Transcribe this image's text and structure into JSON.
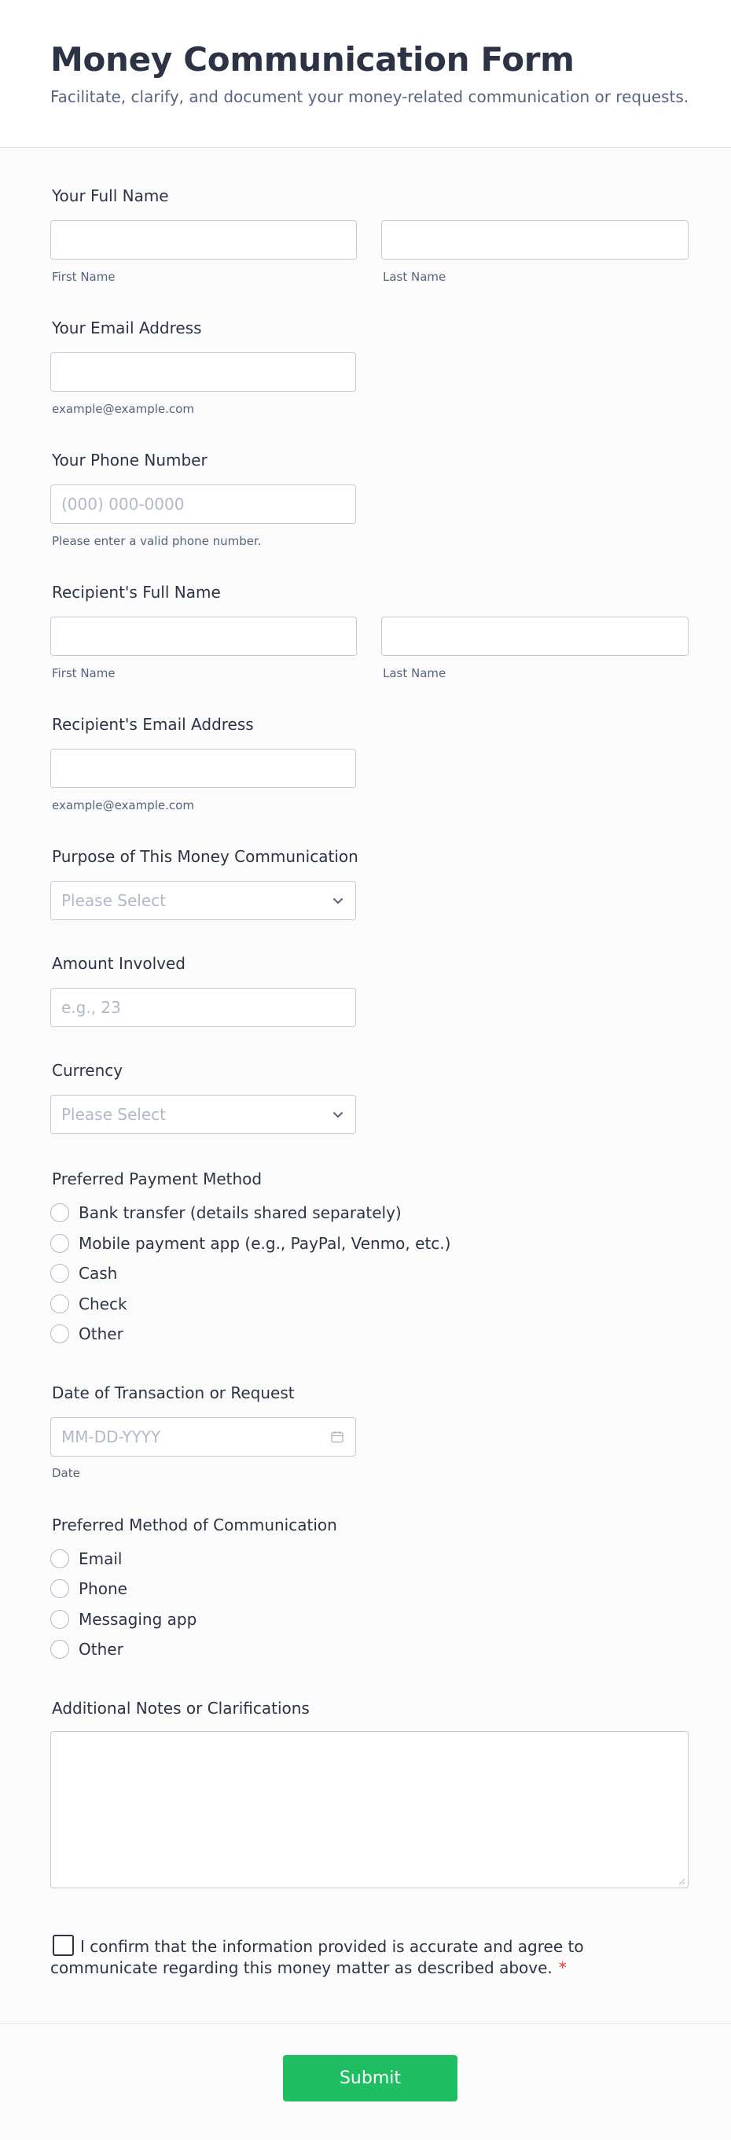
{
  "header": {
    "title": "Money Communication Form",
    "subtitle": "Facilitate, clarify, and document your money-related communication or requests."
  },
  "fields": {
    "full_name": {
      "label": "Your Full Name",
      "first": "First Name",
      "last": "Last Name"
    },
    "email": {
      "label": "Your Email Address",
      "hint": "example@example.com"
    },
    "phone": {
      "label": "Your Phone Number",
      "placeholder": "(000) 000-0000",
      "hint": "Please enter a valid phone number."
    },
    "recipient_name": {
      "label": "Recipient's Full Name",
      "first": "First Name",
      "last": "Last Name"
    },
    "recipient_email": {
      "label": "Recipient's Email Address",
      "hint": "example@example.com"
    },
    "purpose": {
      "label": "Purpose of This Money Communication",
      "placeholder": "Please Select"
    },
    "amount": {
      "label": "Amount Involved",
      "placeholder": "e.g., 23"
    },
    "currency": {
      "label": "Currency",
      "placeholder": "Please Select"
    },
    "payment_method": {
      "label": "Preferred Payment Method",
      "options": [
        "Bank transfer (details shared separately)",
        "Mobile payment app (e.g., PayPal, Venmo, etc.)",
        "Cash",
        "Check",
        "Other"
      ]
    },
    "date": {
      "label": "Date of Transaction or Request",
      "placeholder": "MM-DD-YYYY",
      "hint": "Date"
    },
    "communication_method": {
      "label": "Preferred Method of Communication",
      "options": [
        "Email",
        "Phone",
        "Messaging app",
        "Other"
      ]
    },
    "notes": {
      "label": "Additional Notes or Clarifications"
    },
    "consent": {
      "text": "I confirm that the information provided is accurate and agree to communicate regarding this money matter as described above.",
      "required_mark": "*"
    }
  },
  "submit": {
    "label": "Submit"
  }
}
